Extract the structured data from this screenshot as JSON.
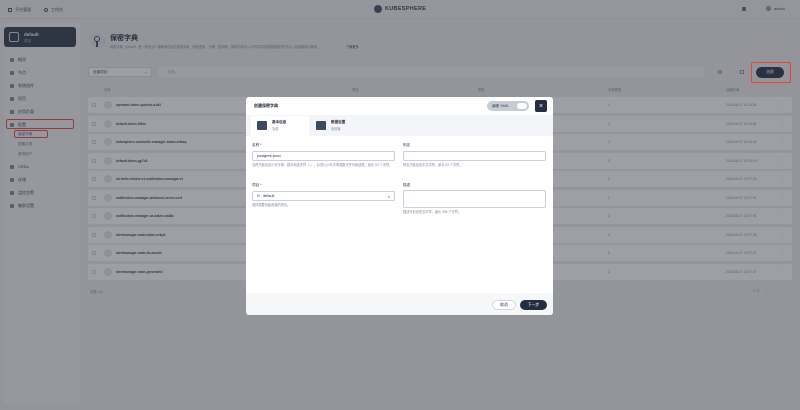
{
  "topbar": {
    "platform": "平台管理",
    "workbench": "工作台",
    "logo": "KUBESPHERE",
    "user": "admin"
  },
  "sidebar": {
    "project_name": "default",
    "project_sub": "项目",
    "items": [
      {
        "label": "概览"
      },
      {
        "label": "节点"
      },
      {
        "label": "系统组件"
      },
      {
        "label": "项目"
      },
      {
        "label": "应用负载"
      },
      {
        "label": "配置"
      },
      {
        "label": "CRDs"
      },
      {
        "label": "存储"
      },
      {
        "label": "监控告警"
      },
      {
        "label": "集群设置"
      }
    ],
    "config_sub": [
      "保密字典",
      "配置字典",
      "服务帐户"
    ]
  },
  "page": {
    "title": "保密字典",
    "description": "保密字典（Secret）是一种包含少量敏感信息的资源对象，例如密码、令牌、密钥等。保密字典可以以环境变量或数据卷的形式注入到容器组中使用。",
    "learn_more": "了解更多",
    "project_select": "全部项目",
    "search_placeholder": "搜索",
    "create_button": "创建",
    "col_name": "名称",
    "col_project": "项目",
    "col_type": "类型",
    "col_count": "字段数量",
    "col_time": "创建时间",
    "total": "总数: 10",
    "pager": "1 / 1",
    "rows": [
      {
        "name": "operator-token-opsrole-a1b3",
        "count": "1",
        "time": "2024-06-07 11:10:36"
      },
      {
        "name": "default-token-5l4hz",
        "count": "3",
        "time": "2024-06-07 11:10:36"
      },
      {
        "name": "kubesphere-controller-manager-token-mfssq",
        "count": "3",
        "time": "2024-06-07 10:34:24"
      },
      {
        "name": "default-token-gp7c8",
        "count": "3",
        "time": "2024-06-07 10:29:10"
      },
      {
        "name": "sh.helm.release.v1.notification-manager.v1",
        "count": "1",
        "time": "2024-06-07 10:27:52"
      },
      {
        "name": "notification-manager-webhook-server-cert",
        "count": "2",
        "time": "2024-06-07 10:27:51"
      },
      {
        "name": "notification-manager-sa-token-ws8kt",
        "count": "3",
        "time": "2024-06-07 10:27:51"
      },
      {
        "name": "alertmanager-main-token-nrkp4",
        "count": "3",
        "time": "2024-06-07 10:27:38"
      },
      {
        "name": "alertmanager-main-tls-assets",
        "count": "0",
        "time": "2024-06-07 10:27:37"
      },
      {
        "name": "alertmanager-main-generated",
        "count": "1",
        "time": "2024-06-07 10:27:37"
      }
    ]
  },
  "modal": {
    "title": "创建保密字典",
    "yaml_toggle": "编辑 YAML",
    "step1_title": "基本信息",
    "step1_sub": "当前",
    "step2_title": "数据设置",
    "step2_sub": "未设置",
    "name_label": "名称 *",
    "name_value": "postgres-prod",
    "name_hint": "名称只能包含小写字母、数字和连字符（-），必须以小写字母或数字开头和结尾，最长 63 个字符。",
    "alias_label": "别名",
    "alias_hint": "别名只能包含中文字符，最长 63 个字符。",
    "project_label": "项目 *",
    "project_value": "default",
    "project_hint": "选择需要创建资源的项目。",
    "desc_label": "描述",
    "desc_hint": "描述可包含任意字符，最长 256 个字符。",
    "cancel": "取消",
    "next": "下一步"
  }
}
